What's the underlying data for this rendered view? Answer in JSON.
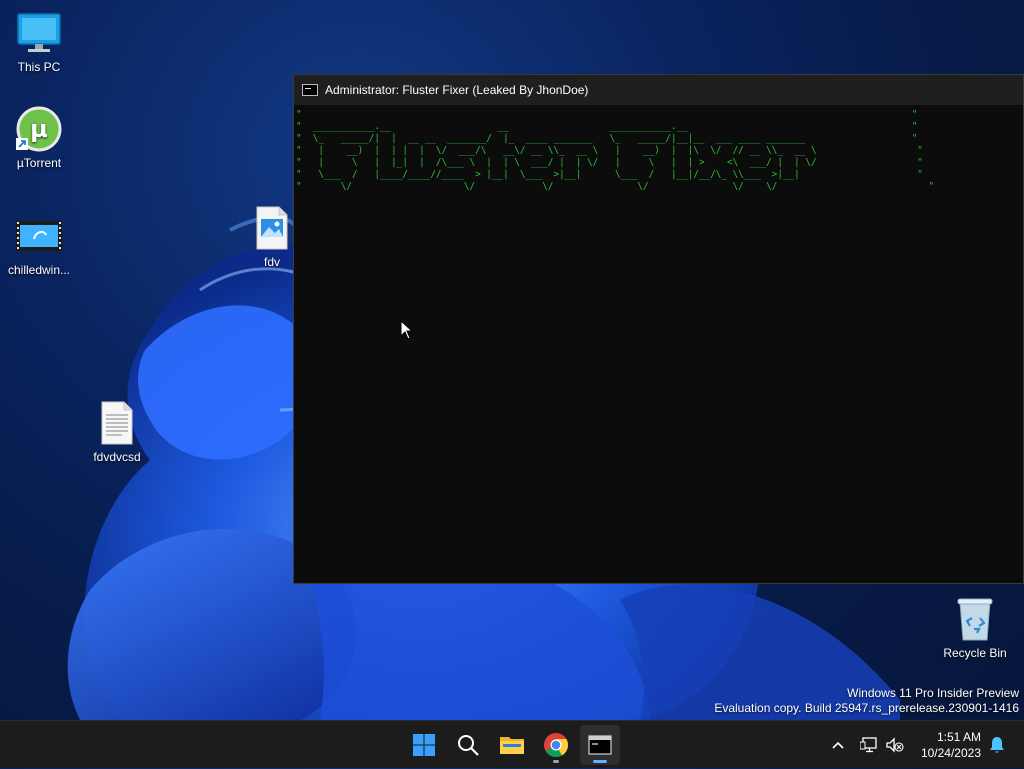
{
  "desktop": {
    "icons": [
      {
        "label": "This PC",
        "icon": "monitor-icon"
      },
      {
        "label": "µTorrent",
        "icon": "utorrent-icon"
      },
      {
        "label": "chilledwin...",
        "icon": "video-file-icon"
      },
      {
        "label": "fdv",
        "icon": "image-file-icon"
      },
      {
        "label": "fdvdvcsd",
        "icon": "text-file-icon"
      },
      {
        "label": "Recycle Bin",
        "icon": "recycle-bin-icon"
      }
    ]
  },
  "console": {
    "title": "Administrator:  Fluster Fixer (Leaked By JhonDoe)",
    "text_color": "#2fbf3a",
    "ascii_lines": [
      "\"                                                                                                             \"",
      "\"  ___________.__                   __                  ___________.__                                        \"",
      "\"  \\_   _____/|  |  __ __  _______/  |_  ____ _______   \\_   _____/|__|__  ___ ____ _______                   \"",
      "\"   |    __)  |  | |  |  \\/  ___/\\   __\\/ __ \\\\_  __ \\   |    __)  |  |\\  \\/  // __ \\\\_  __ \\                  \"",
      "\"   |     \\   |  |_|  |  /\\___ \\  |  | \\  ___/ |  | \\/   |     \\   |  | >    <\\  ___/ |  | \\/                  \"",
      "\"   \\___  /   |____/____//____  > |__|  \\___  >|__|      \\___  /   |__|/__/\\_ \\\\___  >|__|                     \"",
      "\"       \\/                    \\/            \\/               \\/               \\/    \\/                           \""
    ]
  },
  "watermark": {
    "line1": "Windows 11 Pro Insider Preview",
    "line2": "Evaluation copy. Build 25947.rs_prerelease.230901-1416"
  },
  "taskbar": {
    "apps": [
      {
        "name": "start",
        "icon": "windows-logo-icon"
      },
      {
        "name": "search",
        "icon": "search-icon"
      },
      {
        "name": "file-explorer",
        "icon": "folder-icon"
      },
      {
        "name": "chrome",
        "icon": "chrome-icon"
      },
      {
        "name": "terminal",
        "icon": "cmd-icon"
      }
    ],
    "tray": {
      "chevron": "chevron-up-icon",
      "network": "network-icon",
      "volume": "volume-muted-icon",
      "notifications": "bell-icon"
    },
    "clock": {
      "time": "1:51 AM",
      "date": "10/24/2023"
    }
  }
}
